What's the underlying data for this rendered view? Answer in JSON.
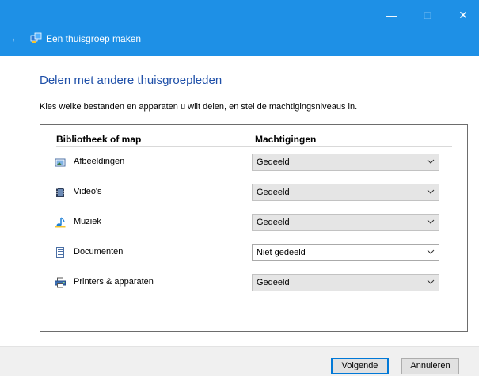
{
  "window": {
    "title": "Een thuisgroep maken",
    "controls": {
      "minimize": "—",
      "maximize": "□",
      "close": "✕"
    },
    "back_icon": "arrow-left-icon"
  },
  "main": {
    "heading": "Delen met andere thuisgroepleden",
    "description": "Kies welke bestanden en apparaten u wilt delen, en stel de machtigingsniveaus in.",
    "columns": {
      "library": "Bibliotheek of map",
      "permissions": "Machtigingen"
    },
    "rows": [
      {
        "label": "Afbeeldingen",
        "permission": "Gedeeld",
        "icon": "pictures-icon"
      },
      {
        "label": "Video's",
        "permission": "Gedeeld",
        "icon": "videos-icon"
      },
      {
        "label": "Muziek",
        "permission": "Gedeeld",
        "icon": "music-icon"
      },
      {
        "label": "Documenten",
        "permission": "Niet gedeeld",
        "icon": "documents-icon"
      },
      {
        "label": "Printers & apparaten",
        "permission": "Gedeeld",
        "icon": "printer-icon"
      }
    ]
  },
  "footer": {
    "next": "Volgende",
    "cancel": "Annuleren"
  },
  "colors": {
    "titlebar": "#1e90e6",
    "heading": "#1e4fa8",
    "accent": "#0078d7"
  }
}
